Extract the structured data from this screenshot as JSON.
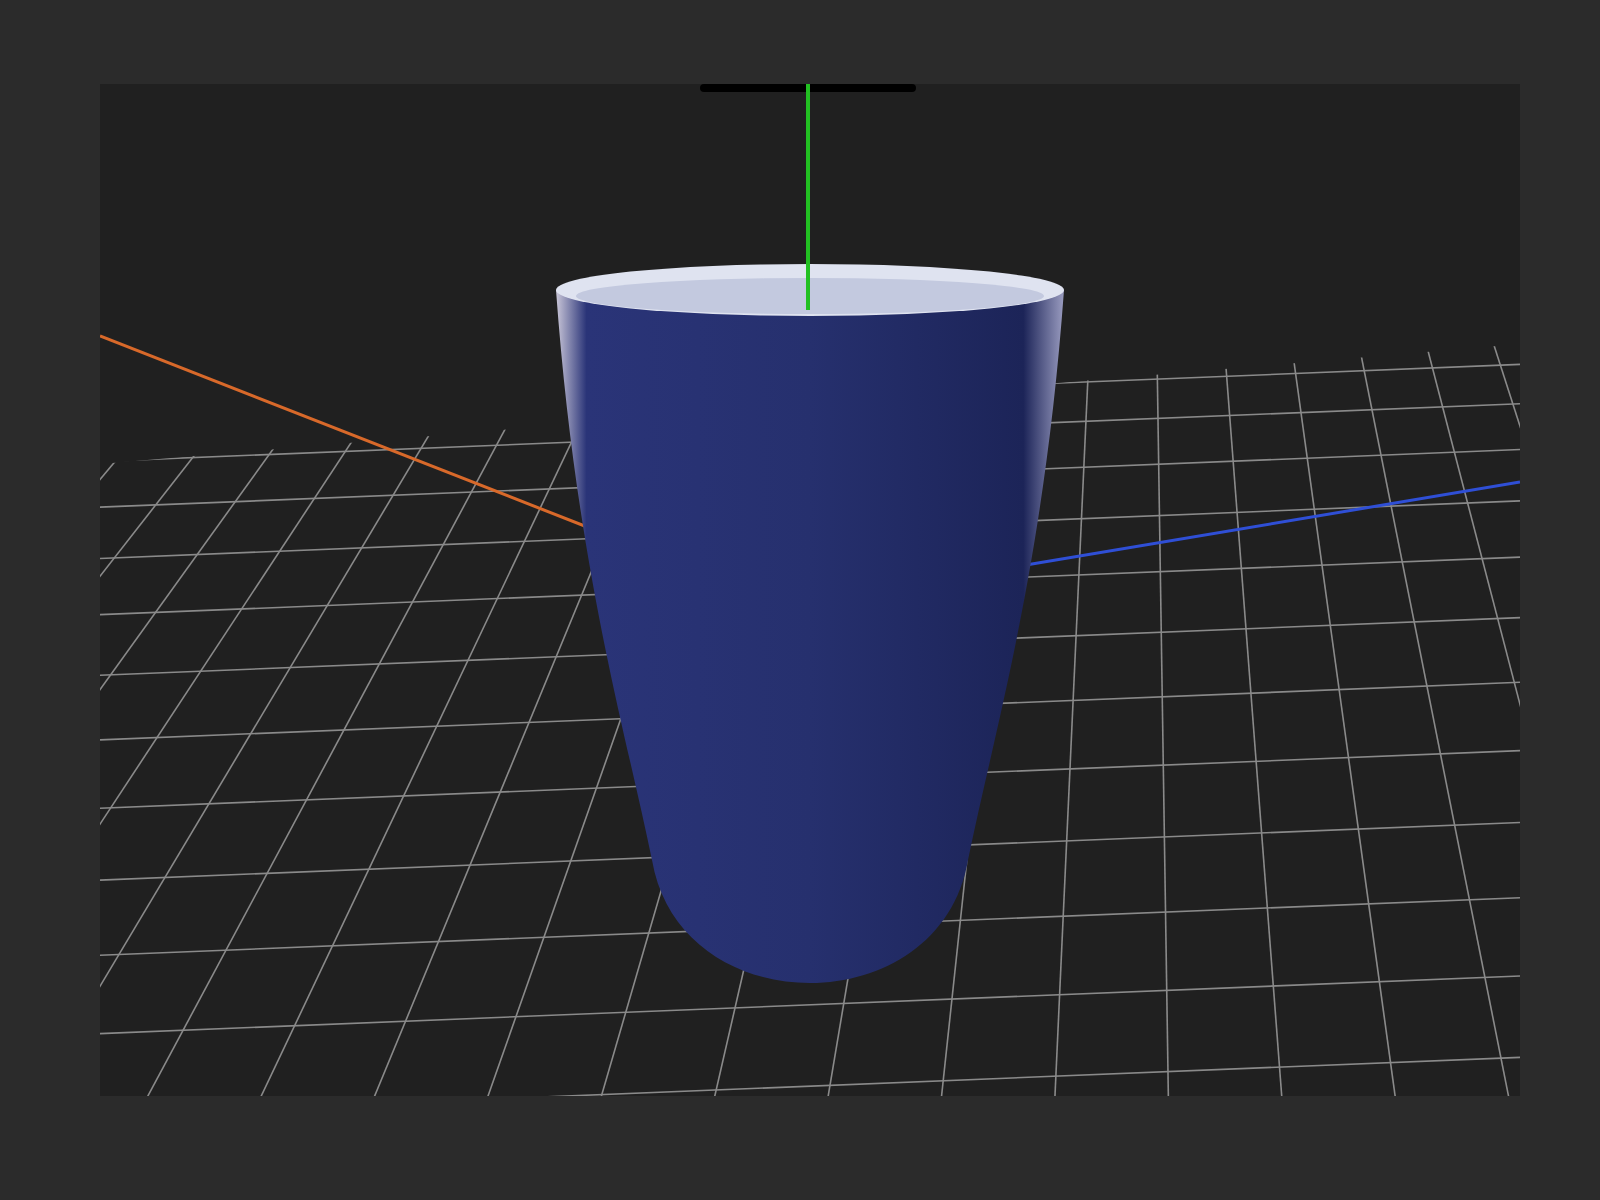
{
  "viewport": {
    "axes": [
      {
        "kind": "x",
        "color": "#d8692a"
      },
      {
        "kind": "z",
        "color": "#2f4fd6"
      },
      {
        "kind": "y",
        "color": "#22c022"
      }
    ]
  }
}
